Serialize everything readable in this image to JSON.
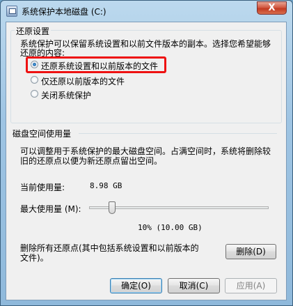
{
  "window": {
    "title": "系统保护本地磁盘 (C:)",
    "close_glyph": "X"
  },
  "restore_settings": {
    "heading": "还原设置",
    "description_line1": "系统保护可以保留系统设置和以前文件版本的副本。选择您希望能够",
    "description_line2": "还原的内容:",
    "options": [
      {
        "label": "还原系统设置和以前版本的文件",
        "selected": true
      },
      {
        "label": "仅还原以前版本的文件",
        "selected": false
      },
      {
        "label": "关闭系统保护",
        "selected": false
      }
    ]
  },
  "disk_usage": {
    "heading": "磁盘空间使用量",
    "description_line1": "可以调整用于系统保护的最大磁盘空间。占满空间时，系统将删除较",
    "description_line2": "旧的还原点以便为新还原点留出空间。",
    "current_label": "当前使用量:",
    "current_value": "8.98 GB",
    "max_label": "最大使用量 (M):",
    "max_value_text": "10% (10.00 GB)",
    "max_fraction": 0.1,
    "delete_text_line1": "删除所有还原点(其中包括系统设置和以前版本的",
    "delete_text_line2": "文件)。",
    "delete_button": "删除(D)"
  },
  "buttons": {
    "ok": "确定(O)",
    "cancel": "取消(C)",
    "apply": "应用(A)"
  },
  "colors": {
    "highlight": "#e11111",
    "title_bar": "#9ec4e3"
  }
}
